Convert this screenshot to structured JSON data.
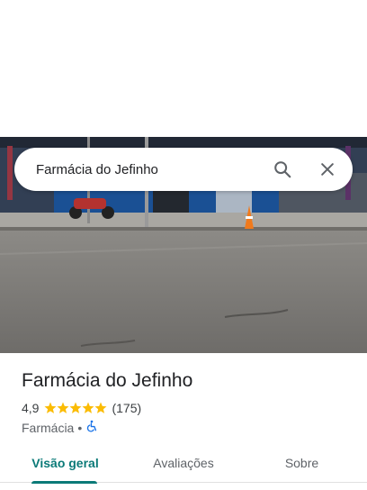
{
  "search": {
    "query": "Farmácia do Jefinho",
    "search_icon": "search-icon",
    "close_icon": "close-icon"
  },
  "photo": {
    "description_icon": "storefront-photo"
  },
  "place": {
    "name": "Farmácia do Jefinho",
    "rating": "4,9",
    "rating_value": 4.9,
    "stars_max": 5,
    "review_count": "(175)",
    "category": "Farmácia",
    "separator": "•",
    "accessibility_icon": "wheelchair-icon"
  },
  "tabs": [
    {
      "label": "Visão geral",
      "active": true
    },
    {
      "label": "Avaliações",
      "active": false
    },
    {
      "label": "Sobre",
      "active": false
    }
  ],
  "colors": {
    "accent": "#0b7a78",
    "star": "#fbbc04",
    "accessibility": "#1a73e8"
  }
}
